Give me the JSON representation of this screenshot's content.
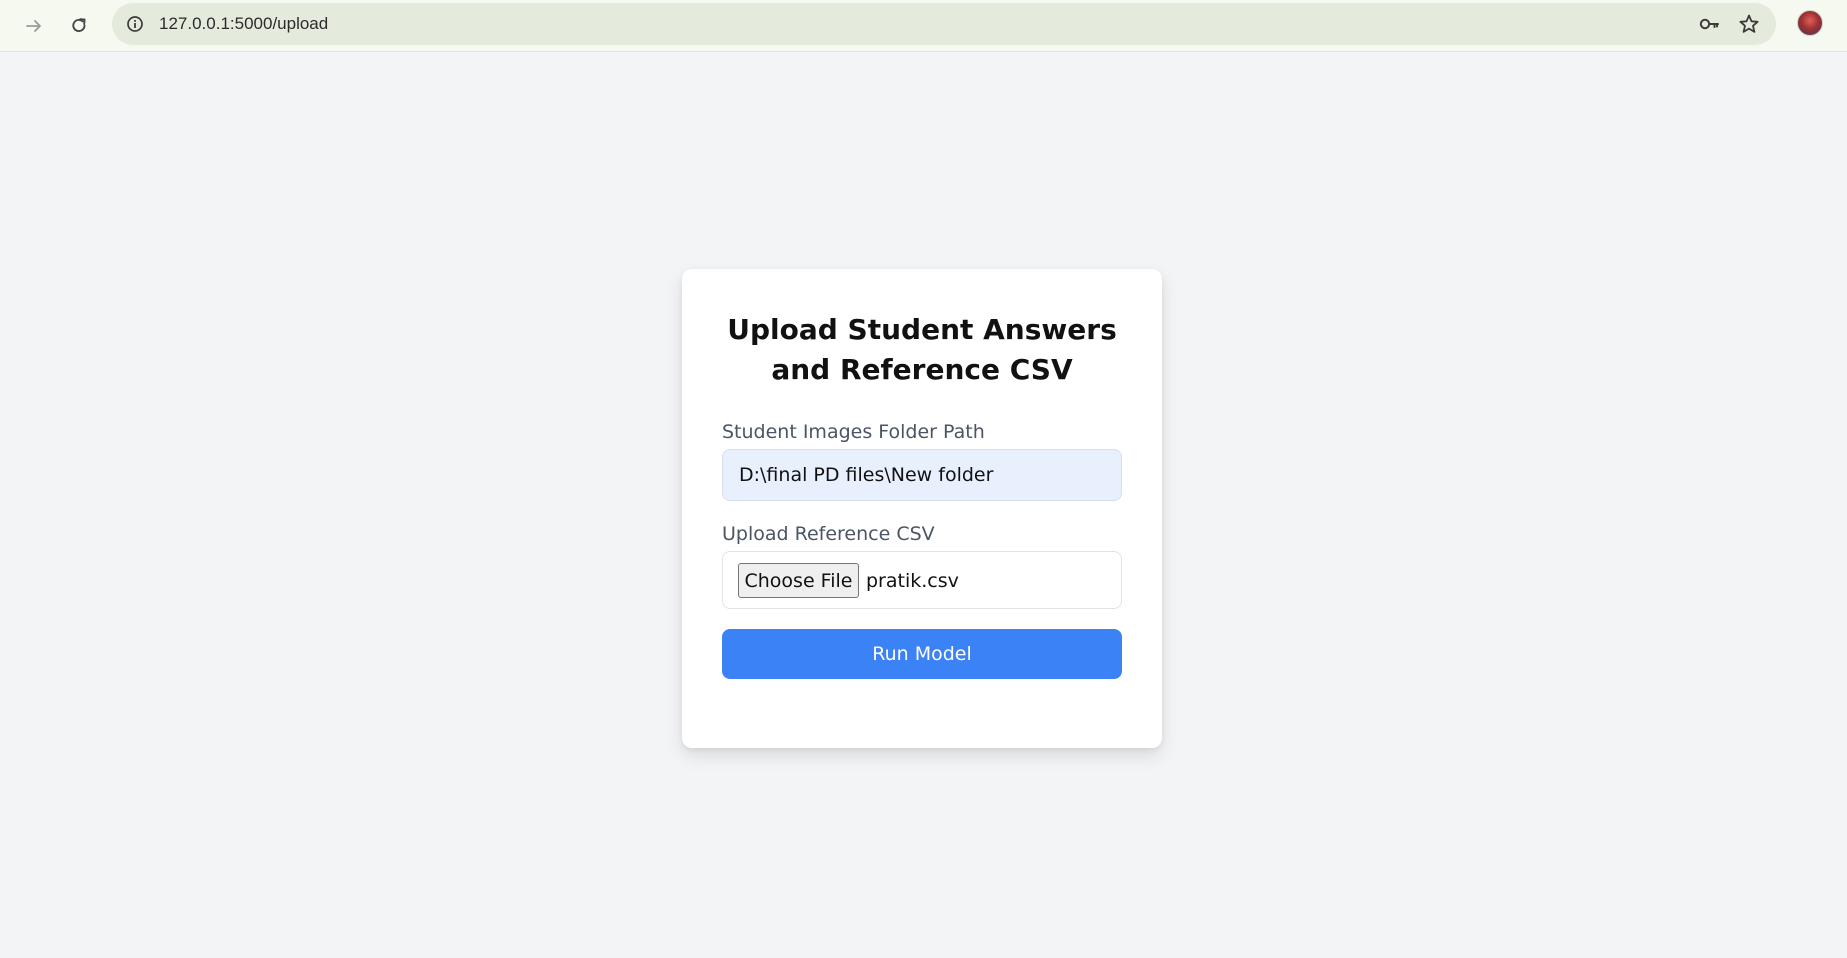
{
  "browser": {
    "url": "127.0.0.1:5000/upload",
    "icons": {
      "forward": "arrow-right-icon",
      "reload": "reload-icon",
      "site_info": "info-icon",
      "password": "key-icon",
      "bookmark": "star-icon",
      "profile": "avatar"
    }
  },
  "form": {
    "title": "Upload Student Answers and Reference CSV",
    "folder_label": "Student Images Folder Path",
    "folder_value": "D:\\final PD files\\New folder",
    "csv_label": "Upload Reference CSV",
    "choose_file_label": "Choose File",
    "selected_file": "pratik.csv",
    "submit_label": "Run Model"
  },
  "colors": {
    "page_bg": "#f3f4f6",
    "card_bg": "#ffffff",
    "input_bg": "#e8f0fe",
    "accent": "#3b82f6"
  }
}
